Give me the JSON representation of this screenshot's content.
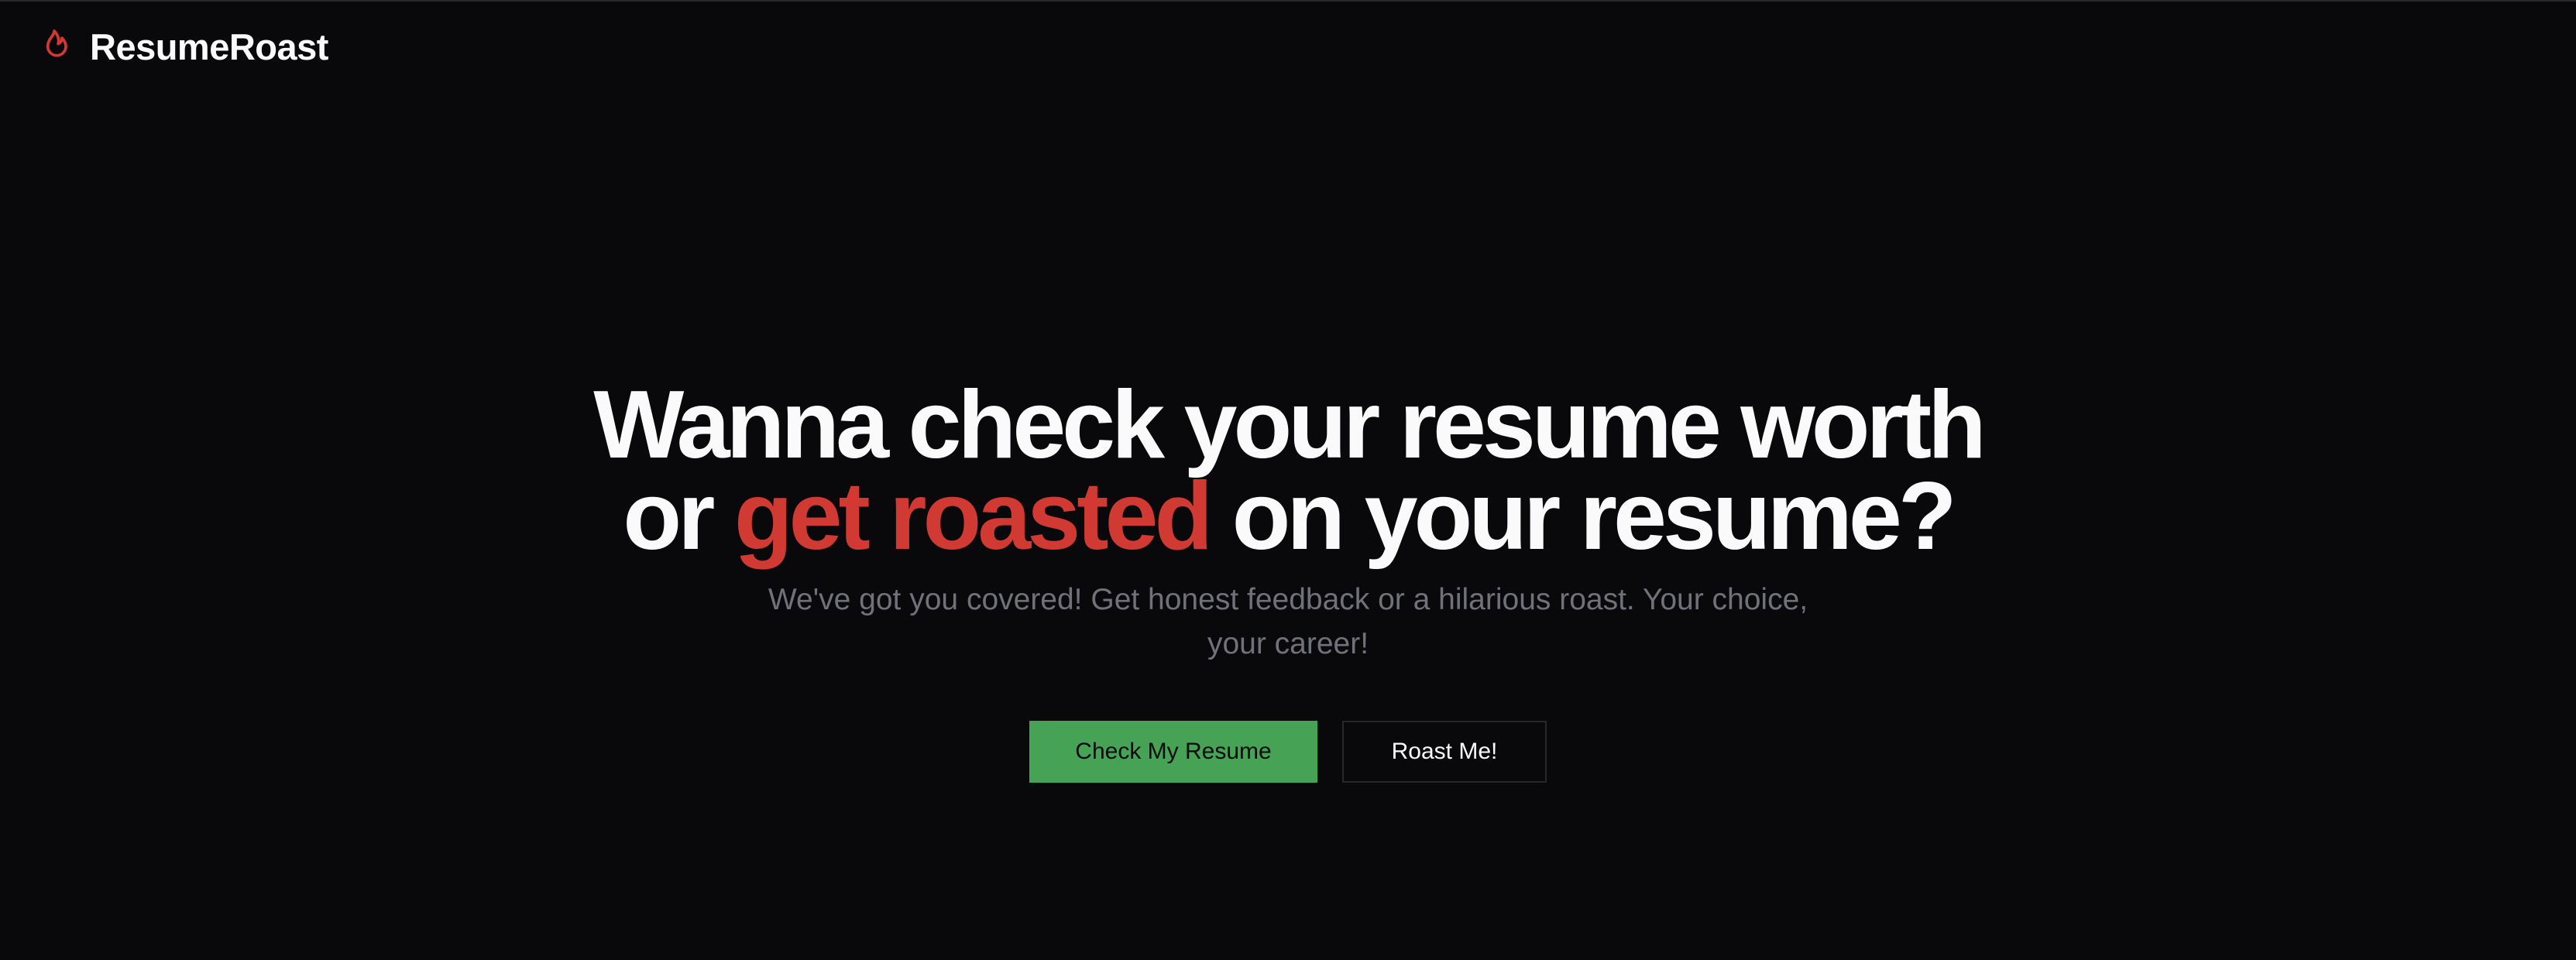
{
  "brand": {
    "name": "ResumeRoast",
    "icon": "flame-icon",
    "accent_color": "#d13a32"
  },
  "hero": {
    "headline_line1": "Wanna check your resume worth",
    "headline_line2_prefix": "or ",
    "headline_accent": "get roasted",
    "headline_line2_suffix": " on your resume?",
    "subtitle": "We've got you covered! Get honest feedback or a hilarious roast. Your choice, your career!"
  },
  "actions": {
    "primary_label": "Check My Resume",
    "primary_color": "#46a254",
    "secondary_label": "Roast Me!"
  },
  "colors": {
    "background": "#09090b",
    "text": "#fafafa",
    "muted_text": "#71717a"
  }
}
